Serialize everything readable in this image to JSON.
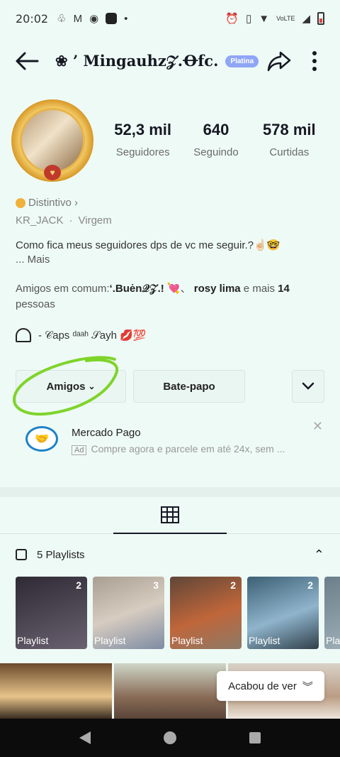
{
  "status_bar": {
    "time": "20:02"
  },
  "header": {
    "username": "❀ ’ Mingauhz𝒵.Ꝋfc.",
    "badge": "Platina"
  },
  "profile": {
    "stats": [
      {
        "value": "52,3 mil",
        "label": "Seguidores"
      },
      {
        "value": "640",
        "label": "Seguindo"
      },
      {
        "value": "578 mil",
        "label": "Curtidas"
      }
    ],
    "badge_label": "Distintivo ›",
    "meta": [
      "KR_JACK",
      "·",
      "Virgem"
    ],
    "bio": "Como fica meus seguidores dps de vc me seguir.?☝🏻🤓",
    "bio_more": "...  Mais",
    "mutual_prefix": "Amigos em comum:",
    "mutual_name1": "‘.Buėn𝒬𝒵.!",
    "mutual_emoji": " 💘、",
    "mutual_name2": "rosy lima",
    "mutual_mid": " e mais ",
    "mutual_count": "14",
    "mutual_suffix": " pessoas",
    "link_text": "- 𝒞aps ᵈᵃᵃʰ 𝒮ayh 💋💯"
  },
  "actions": {
    "friends": "Amigos",
    "chat": "Bate-papo"
  },
  "ad": {
    "title": "Mercado Pago",
    "tag": "Ad",
    "desc": "Compre agora e parcele em até 24x, sem ..."
  },
  "playlists": {
    "title": "5 Playlists",
    "items": [
      {
        "count": "2",
        "label": "Playlist",
        "color": "#3a3340"
      },
      {
        "count": "3",
        "label": "Playlist",
        "color": "#b7a79a"
      },
      {
        "count": "2",
        "label": "Playlist",
        "color": "#8a5c40"
      },
      {
        "count": "2",
        "label": "Playlist",
        "color": "#4e6c7c"
      },
      {
        "count": "",
        "label": "Pla",
        "color": "#6b7f8a"
      }
    ]
  },
  "toast": {
    "label": "Acabou de ver"
  },
  "colors": {
    "background": "#eefaf6",
    "highlight": "#7fd42a",
    "badge": "#8fa5f7"
  }
}
